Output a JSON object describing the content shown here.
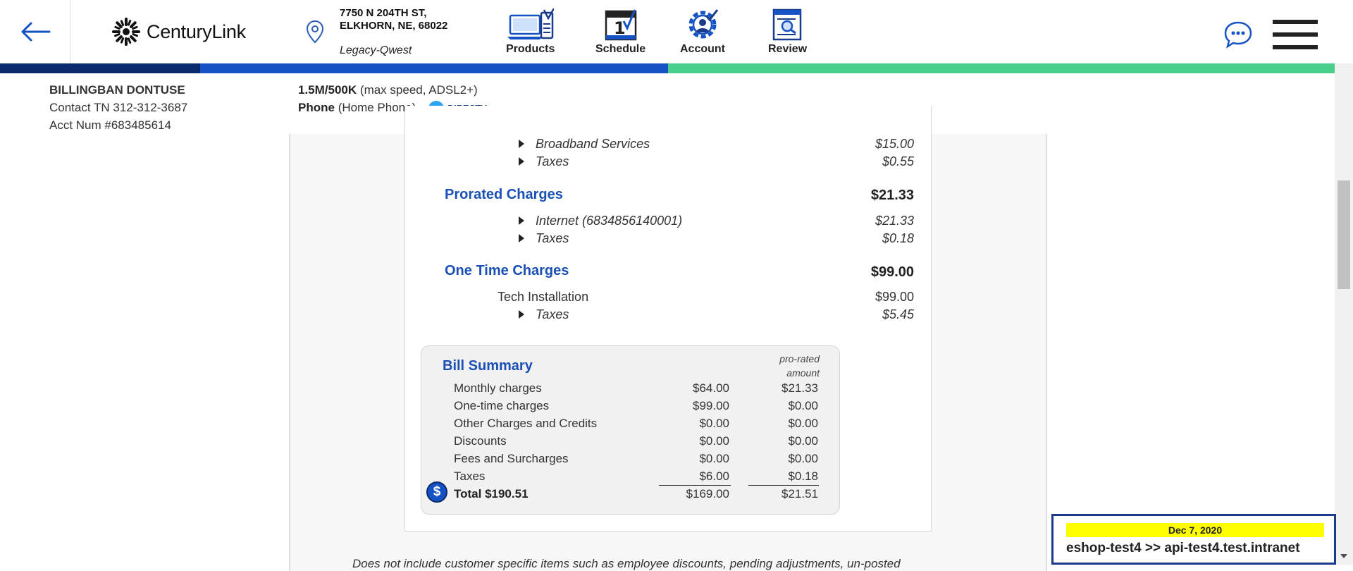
{
  "header": {
    "logo_brand": "CenturyLink",
    "address_line1": "7750 N 204TH ST,",
    "address_line2": "ELKHORN, NE, 68022",
    "legacy": "Legacy-Qwest",
    "nav": {
      "products": "Products",
      "schedule": "Schedule",
      "account": "Account",
      "review": "Review"
    }
  },
  "customer": {
    "name": "BILLINGBAN DONTUSE",
    "contact": "Contact TN 312-312-3687",
    "account": "Acct Num #683485614"
  },
  "service": {
    "speed": "1.5M/500K",
    "speed_detail": "(max speed, ADSL2+)",
    "phone": "Phone",
    "phone_detail": "(Home Phone)",
    "partner": "DIRECTV"
  },
  "bill": {
    "broadband_label": "Broadband Services",
    "broadband_amount": "$15.00",
    "taxes1_label": "Taxes",
    "taxes1_amount": "$0.55",
    "prorated_title": "Prorated Charges",
    "prorated_total": "$21.33",
    "internet_label": "Internet (6834856140001)",
    "internet_amount": "$21.33",
    "taxes2_label": "Taxes",
    "taxes2_amount": "$0.18",
    "onetime_title": "One Time Charges",
    "onetime_total": "$99.00",
    "tech_label": "Tech Installation",
    "tech_amount": "$99.00",
    "taxes3_label": "Taxes",
    "taxes3_amount": "$5.45"
  },
  "summary": {
    "title": "Bill Summary",
    "prorated_head1": "pro-rated",
    "prorated_head2": "amount",
    "rows": [
      {
        "label": "Monthly charges",
        "amount": "$64.00",
        "prorated": "$21.33"
      },
      {
        "label": "One-time charges",
        "amount": "$99.00",
        "prorated": "$0.00"
      },
      {
        "label": "Other Charges and Credits",
        "amount": "$0.00",
        "prorated": "$0.00"
      },
      {
        "label": "Discounts",
        "amount": "$0.00",
        "prorated": "$0.00"
      },
      {
        "label": "Fees and Surcharges",
        "amount": "$0.00",
        "prorated": "$0.00"
      },
      {
        "label": "Taxes",
        "amount": "$6.00",
        "prorated": "$0.18"
      }
    ],
    "total_label": "Total $190.51",
    "total_amount": "$169.00",
    "total_prorated": "$21.51",
    "dollar_symbol": "$"
  },
  "disclaimer": "Does not include customer specific items such as employee discounts, pending adjustments, un-posted",
  "env": {
    "date": "Dec 7, 2020",
    "route": "eshop-test4 >> api-test4.test.intranet"
  },
  "colors": {
    "brand_blue": "#1552c4",
    "navy": "#0a2a6b",
    "green": "#48cf8c",
    "highlight": "#ffff00"
  }
}
